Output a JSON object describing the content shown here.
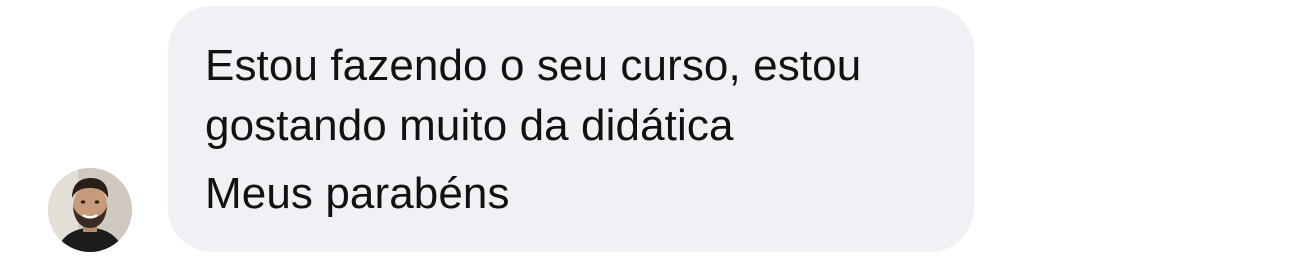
{
  "message": {
    "lines": [
      "Estou fazendo o seu curso, estou",
      "gostando muito da didática",
      "Meus parabéns"
    ]
  },
  "sender": {
    "avatar_icon": "user-avatar-photo"
  },
  "colors": {
    "bubble_background": "#f0f1f5",
    "text": "#111111",
    "page_background": "#ffffff"
  }
}
